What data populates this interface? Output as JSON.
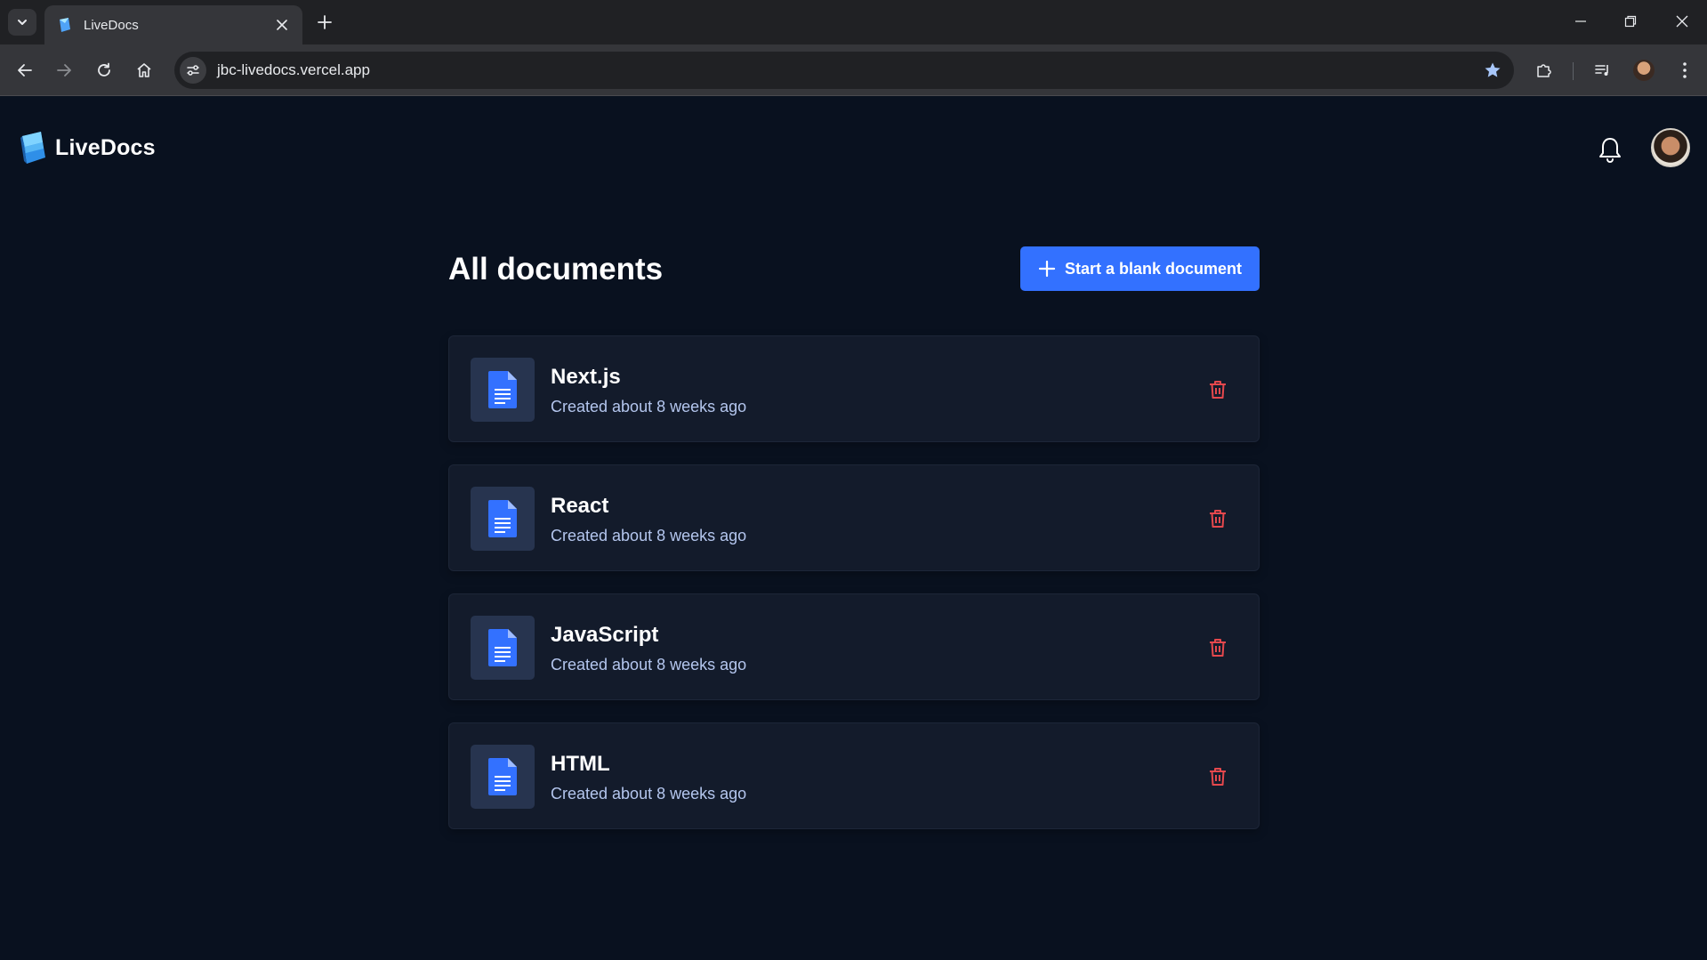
{
  "browser": {
    "tab_title": "LiveDocs",
    "url": "jbc-livedocs.vercel.app"
  },
  "app": {
    "brand_name": "LiveDocs",
    "page_title": "All documents",
    "new_document_label": "Start a blank document",
    "accent_color": "#3371ff",
    "delete_color": "#e5484d"
  },
  "documents": [
    {
      "title": "Next.js",
      "meta": "Created about 8 weeks ago"
    },
    {
      "title": "React",
      "meta": "Created about 8 weeks ago"
    },
    {
      "title": "JavaScript",
      "meta": "Created about 8 weeks ago"
    },
    {
      "title": "HTML",
      "meta": "Created about 8 weeks ago"
    }
  ],
  "icons": {
    "tab_search": "chevron-down-icon",
    "back": "arrow-left-icon",
    "forward": "arrow-right-icon",
    "reload": "reload-icon",
    "home": "home-icon",
    "site_info": "tune-icon",
    "bookmark": "star-icon",
    "extensions": "puzzle-icon",
    "media": "media-queue-icon",
    "menu": "kebab-menu-icon",
    "notifications": "bell-icon",
    "document": "document-icon",
    "delete": "trash-icon"
  }
}
